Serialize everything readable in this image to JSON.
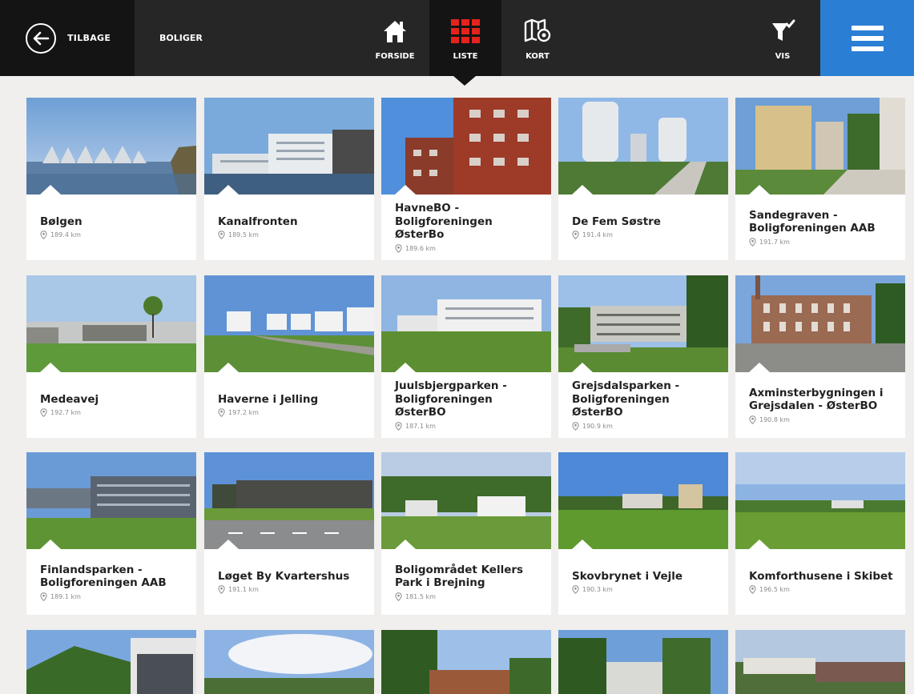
{
  "topbar": {
    "back_label": "TILBAGE",
    "breadcrumb": "BOLIGER",
    "nav": [
      {
        "label": "FORSIDE",
        "icon": "home-icon"
      },
      {
        "label": "LISTE",
        "icon": "list-grid-icon"
      },
      {
        "label": "KORT",
        "icon": "map-icon"
      },
      {
        "label": "VIS",
        "icon": "filter-icon"
      }
    ],
    "active_tab": "LISTE",
    "menu_icon": "hamburger-menu-icon",
    "colors": {
      "bar": "#262626",
      "active": "#141414",
      "menu": "#2a7fd4"
    }
  },
  "listings": [
    {
      "name": "Bølgen",
      "distance": "189.4 km"
    },
    {
      "name": "Kanalfronten",
      "distance": "189.5 km"
    },
    {
      "name": "HavneBO - Boligforeningen ØsterBo",
      "distance": "189.6 km"
    },
    {
      "name": "De Fem Søstre",
      "distance": "191.4 km"
    },
    {
      "name": "Sandegraven - Boligforeningen AAB",
      "distance": "191.7 km"
    },
    {
      "name": "Medeavej",
      "distance": "192.7 km"
    },
    {
      "name": "Haverne i Jelling",
      "distance": "197.2 km"
    },
    {
      "name": "Juulsbjergparken - Boligforeningen ØsterBO",
      "distance": "187.1 km"
    },
    {
      "name": "Grejsdalsparken - Boligforeningen ØsterBO",
      "distance": "190.9 km"
    },
    {
      "name": "Axminsterbygningen i Grejsdalen - ØsterBO",
      "distance": "190.8 km"
    },
    {
      "name": "Finlandsparken - Boligforeningen AAB",
      "distance": "189.1 km"
    },
    {
      "name": "Løget By Kvartershus",
      "distance": "191.1 km"
    },
    {
      "name": "Boligområdet Kellers Park i Brejning",
      "distance": "181.5 km"
    },
    {
      "name": "Skovbrynet i Vejle",
      "distance": "190.3 km"
    },
    {
      "name": "Komforthusene i Skibet",
      "distance": "196.5 km"
    }
  ]
}
